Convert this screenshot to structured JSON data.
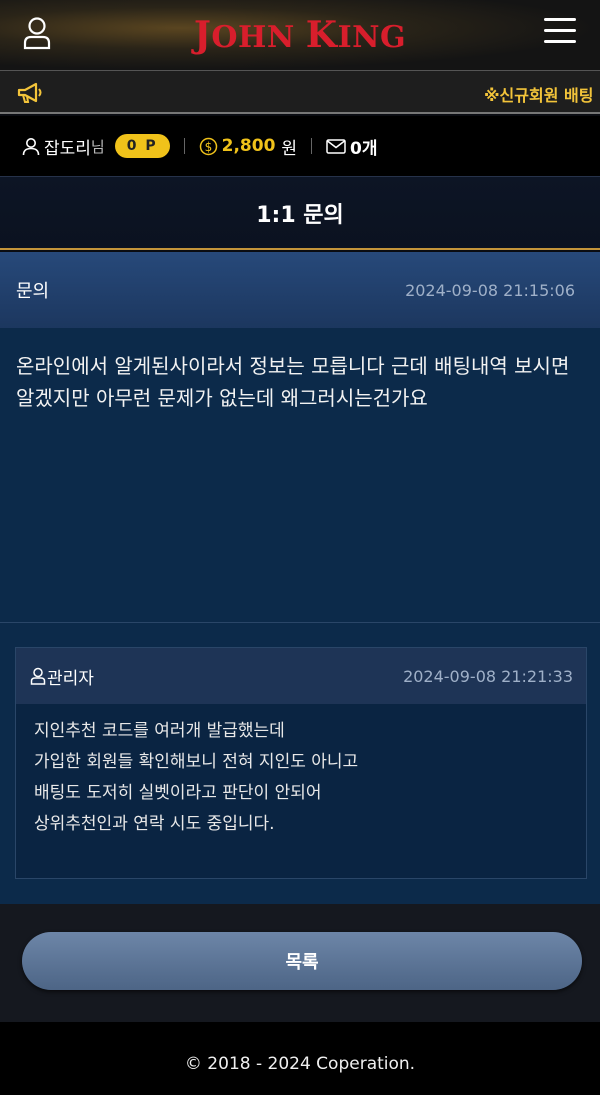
{
  "header": {
    "logo_first": "JOHN",
    "logo_second": "KING",
    "brand_color": "#d81e2c"
  },
  "notice": {
    "text": "※신규회원 배팅"
  },
  "user": {
    "nickname": "잡도리",
    "suffix": "님",
    "points": "0 P",
    "money": "2,800",
    "money_unit": "원",
    "messages": "0개",
    "accent_color": "#f0c21a"
  },
  "page": {
    "title": "1:1 문의"
  },
  "inquiry": {
    "label": "문의",
    "date": "2024-09-08 21:15:06",
    "body": "온라인에서 알게된사이라서 정보는 모릅니다 근데 배팅내역 보시면 알겠지만 아무런 문제가 없는데 왜그러시는건가요"
  },
  "reply": {
    "author": "관리자",
    "date": "2024-09-08 21:21:33",
    "lines": [
      "지인추천 코드를 여러개 발급했는데",
      "가입한 회원들 확인해보니 전혀 지인도 아니고",
      "배팅도 도저히 실벳이라고 판단이 안되어",
      "상위추천인과 연락 시도 중입니다."
    ]
  },
  "actions": {
    "list_label": "목록"
  },
  "footer": {
    "copyright": "© 2018 - 2024 Coperation."
  }
}
